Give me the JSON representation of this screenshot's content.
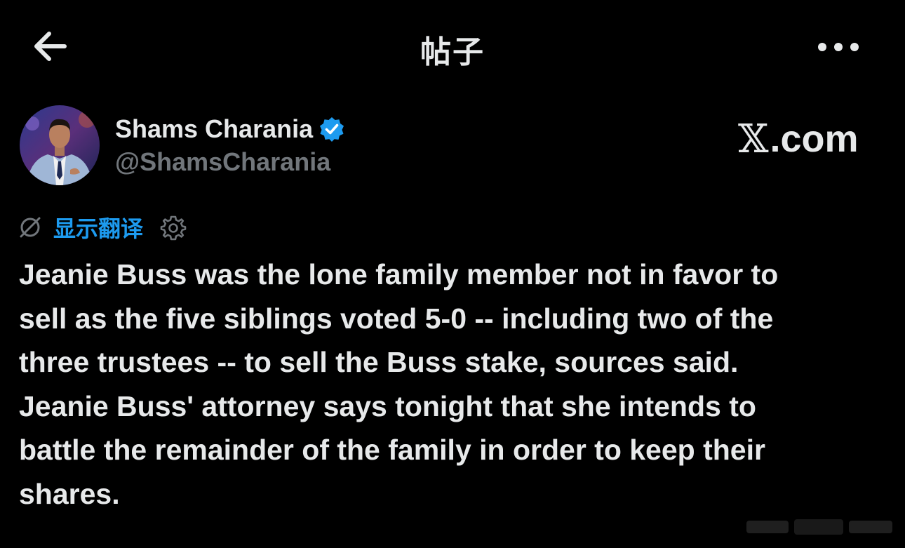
{
  "header": {
    "title": "帖子",
    "back_icon": "arrow-left-icon",
    "more_icon": "more-horizontal-icon"
  },
  "author": {
    "display_name": "Shams Charania",
    "handle": "@ShamsCharania",
    "verified": true,
    "verified_color": "#1d9bf0"
  },
  "brand": {
    "logo_x": "𝕏",
    "logo_suffix": ".com"
  },
  "translate": {
    "label": "显示翻译",
    "label_color": "#1d9bf0",
    "globe_icon": "globe-slash-icon",
    "settings_icon": "gear-icon"
  },
  "tweet": {
    "lines": [
      "Jeanie Buss was the lone family member not in favor to",
      "sell as the five siblings voted 5-0 -- including two of the",
      "three trustees -- to sell the Buss stake, sources said.",
      "Jeanie Buss' attorney says tonight that she intends to",
      "battle the remainder of the family in order to keep their",
      "shares."
    ]
  },
  "colors": {
    "background": "#000000",
    "text_primary": "#e7e9ea",
    "text_secondary": "#71767b",
    "accent": "#1d9bf0"
  }
}
